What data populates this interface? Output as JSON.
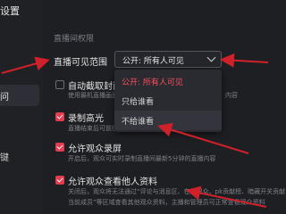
{
  "window": {
    "title": "设置"
  },
  "sidebar": {
    "active_item": "问",
    "bottom_item": "键"
  },
  "section": {
    "title": "直播间权限"
  },
  "visibility": {
    "label": "直播可见范围",
    "selected": "公开: 所有人可见",
    "options": [
      "公开: 所有人可见",
      "只给谁看",
      "不给谁看"
    ]
  },
  "rows": [
    {
      "label": "自动截取封面",
      "desc": "使用最机直播画面",
      "desc_tail": "内容",
      "checked": false
    },
    {
      "label": "录制高光",
      "desc": "直播结束后可前往",
      "checked": true
    },
    {
      "label": "允许观众录屏",
      "desc": "开启后，观众可实时录制直播间最新5分钟的直播内容",
      "checked": true
    },
    {
      "label": "允许观众查看他人资料",
      "desc": "关闭后，观众将无法通过“评论与消息区、在线观众、pk贡献榜、暗藏开关贡献",
      "desc2": "当前成员”等区域查看其他观众资料，主播和管理员可正常查看观众资料",
      "checked": true
    }
  ],
  "colors": {
    "accent": "#e23d4e",
    "arrow": "#d0202a",
    "selected_option": "#ff4d5a"
  }
}
